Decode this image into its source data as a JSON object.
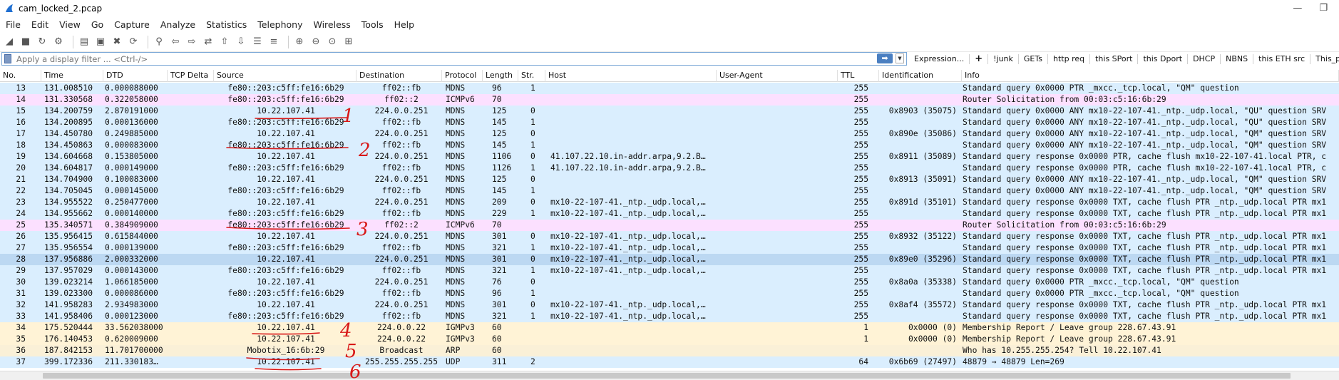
{
  "window": {
    "title": "cam_locked_2.pcap",
    "minimize_glyph": "—",
    "restore_glyph": "❐",
    "app_icon": "shark-fin-icon"
  },
  "menu": [
    "File",
    "Edit",
    "View",
    "Go",
    "Capture",
    "Analyze",
    "Statistics",
    "Telephony",
    "Wireless",
    "Tools",
    "Help"
  ],
  "toolbar": {
    "icons": [
      "start-capture-icon",
      "stop-capture-icon",
      "restart-capture-icon",
      "capture-options-icon",
      "open-file-icon",
      "save-file-icon",
      "close-file-icon",
      "reload-file-icon",
      "find-packet-icon",
      "go-back-icon",
      "go-forward-icon",
      "go-to-packet-icon",
      "go-first-icon",
      "go-last-icon",
      "auto-scroll-icon",
      "colorize-icon",
      "zoom-in-icon",
      "zoom-out-icon",
      "zoom-normal-icon",
      "resize-columns-icon"
    ]
  },
  "filter": {
    "placeholder": "Apply a display filter ... <Ctrl-/>",
    "value": "",
    "apply_glyph": "➡",
    "dropdown_glyph": "▼",
    "buttons": [
      "Expression...",
      "+",
      "!junk",
      "GETs",
      "http req",
      "this SPort",
      "this Dport",
      "DHCP",
      "NBNS",
      "this ETH src",
      "This_program"
    ]
  },
  "columns": [
    "No.",
    "Time",
    "DTD",
    "TCP Delta",
    "Source",
    "Destination",
    "Protocol",
    "Length",
    "Str.",
    "Host",
    "User-Agent",
    "TTL",
    "Identification",
    "Info"
  ],
  "packets": [
    {
      "no": "13",
      "time": "131.008510",
      "dtd": "0.000088000",
      "delta": "",
      "src": "fe80::203:c5ff:fe16:6b29",
      "dst": "ff02::fb",
      "proto": "MDNS",
      "len": "96",
      "str": "1",
      "host": "",
      "ttl": "255",
      "id": "",
      "info": "Standard query 0x0000 PTR _mxcc._tcp.local, \"QM\" question",
      "color": "#daeefe"
    },
    {
      "no": "14",
      "time": "131.330568",
      "dtd": "0.322058000",
      "delta": "",
      "src": "fe80::203:c5ff:fe16:6b29",
      "dst": "ff02::2",
      "proto": "ICMPv6",
      "len": "70",
      "str": "",
      "host": "",
      "ttl": "255",
      "id": "",
      "info": "Router Solicitation from 00:03:c5:16:6b:29",
      "color": "#fce0ff"
    },
    {
      "no": "15",
      "time": "134.200759",
      "dtd": "2.870191000",
      "delta": "",
      "src": "10.22.107.41",
      "dst": "224.0.0.251",
      "proto": "MDNS",
      "len": "125",
      "str": "0",
      "host": "",
      "ttl": "255",
      "id": "0x8903 (35075)",
      "info": "Standard query 0x0000 ANY mx10-22-107-41._ntp._udp.local, \"QU\" question SRV",
      "color": "#daeefe"
    },
    {
      "no": "16",
      "time": "134.200895",
      "dtd": "0.000136000",
      "delta": "",
      "src": "fe80::203:c5ff:fe16:6b29",
      "dst": "ff02::fb",
      "proto": "MDNS",
      "len": "145",
      "str": "1",
      "host": "",
      "ttl": "255",
      "id": "",
      "info": "Standard query 0x0000 ANY mx10-22-107-41._ntp._udp.local, \"QU\" question SRV",
      "color": "#daeefe"
    },
    {
      "no": "17",
      "time": "134.450780",
      "dtd": "0.249885000",
      "delta": "",
      "src": "10.22.107.41",
      "dst": "224.0.0.251",
      "proto": "MDNS",
      "len": "125",
      "str": "0",
      "host": "",
      "ttl": "255",
      "id": "0x890e (35086)",
      "info": "Standard query 0x0000 ANY mx10-22-107-41._ntp._udp.local, \"QM\" question SRV",
      "color": "#daeefe"
    },
    {
      "no": "18",
      "time": "134.450863",
      "dtd": "0.000083000",
      "delta": "",
      "src": "fe80::203:c5ff:fe16:6b29",
      "dst": "ff02::fb",
      "proto": "MDNS",
      "len": "145",
      "str": "1",
      "host": "",
      "ttl": "255",
      "id": "",
      "info": "Standard query 0x0000 ANY mx10-22-107-41._ntp._udp.local, \"QM\" question SRV",
      "color": "#daeefe"
    },
    {
      "no": "19",
      "time": "134.604668",
      "dtd": "0.153805000",
      "delta": "",
      "src": "10.22.107.41",
      "dst": "224.0.0.251",
      "proto": "MDNS",
      "len": "1106",
      "str": "0",
      "host": "41.107.22.10.in-addr.arpa,9.2.B…",
      "ttl": "255",
      "id": "0x8911 (35089)",
      "info": "Standard query response 0x0000 PTR, cache flush mx10-22-107-41.local PTR, c",
      "color": "#daeefe"
    },
    {
      "no": "20",
      "time": "134.604817",
      "dtd": "0.000149000",
      "delta": "",
      "src": "fe80::203:c5ff:fe16:6b29",
      "dst": "ff02::fb",
      "proto": "MDNS",
      "len": "1126",
      "str": "1",
      "host": "41.107.22.10.in-addr.arpa,9.2.B…",
      "ttl": "255",
      "id": "",
      "info": "Standard query response 0x0000 PTR, cache flush mx10-22-107-41.local PTR, c",
      "color": "#daeefe"
    },
    {
      "no": "21",
      "time": "134.704900",
      "dtd": "0.100083000",
      "delta": "",
      "src": "10.22.107.41",
      "dst": "224.0.0.251",
      "proto": "MDNS",
      "len": "125",
      "str": "0",
      "host": "",
      "ttl": "255",
      "id": "0x8913 (35091)",
      "info": "Standard query 0x0000 ANY mx10-22-107-41._ntp._udp.local, \"QM\" question SRV",
      "color": "#daeefe"
    },
    {
      "no": "22",
      "time": "134.705045",
      "dtd": "0.000145000",
      "delta": "",
      "src": "fe80::203:c5ff:fe16:6b29",
      "dst": "ff02::fb",
      "proto": "MDNS",
      "len": "145",
      "str": "1",
      "host": "",
      "ttl": "255",
      "id": "",
      "info": "Standard query 0x0000 ANY mx10-22-107-41._ntp._udp.local, \"QM\" question SRV",
      "color": "#daeefe"
    },
    {
      "no": "23",
      "time": "134.955522",
      "dtd": "0.250477000",
      "delta": "",
      "src": "10.22.107.41",
      "dst": "224.0.0.251",
      "proto": "MDNS",
      "len": "209",
      "str": "0",
      "host": "mx10-22-107-41._ntp._udp.local,…",
      "ttl": "255",
      "id": "0x891d (35101)",
      "info": "Standard query response 0x0000 TXT, cache flush PTR _ntp._udp.local PTR mx1",
      "color": "#daeefe"
    },
    {
      "no": "24",
      "time": "134.955662",
      "dtd": "0.000140000",
      "delta": "",
      "src": "fe80::203:c5ff:fe16:6b29",
      "dst": "ff02::fb",
      "proto": "MDNS",
      "len": "229",
      "str": "1",
      "host": "mx10-22-107-41._ntp._udp.local,…",
      "ttl": "255",
      "id": "",
      "info": "Standard query response 0x0000 TXT, cache flush PTR _ntp._udp.local PTR mx1",
      "color": "#daeefe"
    },
    {
      "no": "25",
      "time": "135.340571",
      "dtd": "0.384909000",
      "delta": "",
      "src": "fe80::203:c5ff:fe16:6b29",
      "dst": "ff02::2",
      "proto": "ICMPv6",
      "len": "70",
      "str": "",
      "host": "",
      "ttl": "255",
      "id": "",
      "info": "Router Solicitation from 00:03:c5:16:6b:29",
      "color": "#fce0ff"
    },
    {
      "no": "26",
      "time": "135.956415",
      "dtd": "0.615844000",
      "delta": "",
      "src": "10.22.107.41",
      "dst": "224.0.0.251",
      "proto": "MDNS",
      "len": "301",
      "str": "0",
      "host": "mx10-22-107-41._ntp._udp.local,…",
      "ttl": "255",
      "id": "0x8932 (35122)",
      "info": "Standard query response 0x0000 TXT, cache flush PTR _ntp._udp.local PTR mx1",
      "color": "#daeefe"
    },
    {
      "no": "27",
      "time": "135.956554",
      "dtd": "0.000139000",
      "delta": "",
      "src": "fe80::203:c5ff:fe16:6b29",
      "dst": "ff02::fb",
      "proto": "MDNS",
      "len": "321",
      "str": "1",
      "host": "mx10-22-107-41._ntp._udp.local,…",
      "ttl": "255",
      "id": "",
      "info": "Standard query response 0x0000 TXT, cache flush PTR _ntp._udp.local PTR mx1",
      "color": "#daeefe"
    },
    {
      "no": "28",
      "time": "137.956886",
      "dtd": "2.000332000",
      "delta": "",
      "src": "10.22.107.41",
      "dst": "224.0.0.251",
      "proto": "MDNS",
      "len": "301",
      "str": "0",
      "host": "mx10-22-107-41._ntp._udp.local,…",
      "ttl": "255",
      "id": "0x89e0 (35296)",
      "info": "Standard query response 0x0000 TXT, cache flush PTR _ntp._udp.local PTR mx1",
      "color": "#bcd8f2"
    },
    {
      "no": "29",
      "time": "137.957029",
      "dtd": "0.000143000",
      "delta": "",
      "src": "fe80::203:c5ff:fe16:6b29",
      "dst": "ff02::fb",
      "proto": "MDNS",
      "len": "321",
      "str": "1",
      "host": "mx10-22-107-41._ntp._udp.local,…",
      "ttl": "255",
      "id": "",
      "info": "Standard query response 0x0000 TXT, cache flush PTR _ntp._udp.local PTR mx1",
      "color": "#daeefe"
    },
    {
      "no": "30",
      "time": "139.023214",
      "dtd": "1.066185000",
      "delta": "",
      "src": "10.22.107.41",
      "dst": "224.0.0.251",
      "proto": "MDNS",
      "len": "76",
      "str": "0",
      "host": "",
      "ttl": "255",
      "id": "0x8a0a (35338)",
      "info": "Standard query 0x0000 PTR _mxcc._tcp.local, \"QM\" question",
      "color": "#daeefe"
    },
    {
      "no": "31",
      "time": "139.023300",
      "dtd": "0.000086000",
      "delta": "",
      "src": "fe80::203:c5ff:fe16:6b29",
      "dst": "ff02::fb",
      "proto": "MDNS",
      "len": "96",
      "str": "1",
      "host": "",
      "ttl": "255",
      "id": "",
      "info": "Standard query 0x0000 PTR _mxcc._tcp.local, \"QM\" question",
      "color": "#daeefe"
    },
    {
      "no": "32",
      "time": "141.958283",
      "dtd": "2.934983000",
      "delta": "",
      "src": "10.22.107.41",
      "dst": "224.0.0.251",
      "proto": "MDNS",
      "len": "301",
      "str": "0",
      "host": "mx10-22-107-41._ntp._udp.local,…",
      "ttl": "255",
      "id": "0x8af4 (35572)",
      "info": "Standard query response 0x0000 TXT, cache flush PTR _ntp._udp.local PTR mx1",
      "color": "#daeefe"
    },
    {
      "no": "33",
      "time": "141.958406",
      "dtd": "0.000123000",
      "delta": "",
      "src": "fe80::203:c5ff:fe16:6b29",
      "dst": "ff02::fb",
      "proto": "MDNS",
      "len": "321",
      "str": "1",
      "host": "mx10-22-107-41._ntp._udp.local,…",
      "ttl": "255",
      "id": "",
      "info": "Standard query response 0x0000 TXT, cache flush PTR _ntp._udp.local PTR mx1",
      "color": "#daeefe"
    },
    {
      "no": "34",
      "time": "175.520444",
      "dtd": "33.562038000",
      "delta": "",
      "src": "10.22.107.41",
      "dst": "224.0.0.22",
      "proto": "IGMPv3",
      "len": "60",
      "str": "",
      "host": "",
      "ttl": "1",
      "id": "0x0000 (0)",
      "info": "Membership Report / Leave group 228.67.43.91",
      "color": "#fff3d6"
    },
    {
      "no": "35",
      "time": "176.140453",
      "dtd": "0.620009000",
      "delta": "",
      "src": "10.22.107.41",
      "dst": "224.0.0.22",
      "proto": "IGMPv3",
      "len": "60",
      "str": "",
      "host": "",
      "ttl": "1",
      "id": "0x0000 (0)",
      "info": "Membership Report / Leave group 228.67.43.91",
      "color": "#fff3d6"
    },
    {
      "no": "36",
      "time": "187.842153",
      "dtd": "11.701700000",
      "delta": "",
      "src": "Mobotix_16:6b:29",
      "dst": "Broadcast",
      "proto": "ARP",
      "len": "60",
      "str": "",
      "host": "",
      "ttl": "",
      "id": "",
      "info": "Who has 10.255.255.254? Tell 10.22.107.41",
      "color": "#faf0d7"
    },
    {
      "no": "37",
      "time": "399.172336",
      "dtd": "211.330183…",
      "delta": "",
      "src": "10.22.107.41",
      "dst": "255.255.255.255",
      "proto": "UDP",
      "len": "311",
      "str": "2",
      "host": "",
      "ttl": "64",
      "id": "0x6b69 (27497)",
      "info": "48879 → 48879 Len=269",
      "color": "#daeefe"
    }
  ],
  "annotations": [
    "1",
    "2",
    "3",
    "4",
    "5",
    "6"
  ]
}
